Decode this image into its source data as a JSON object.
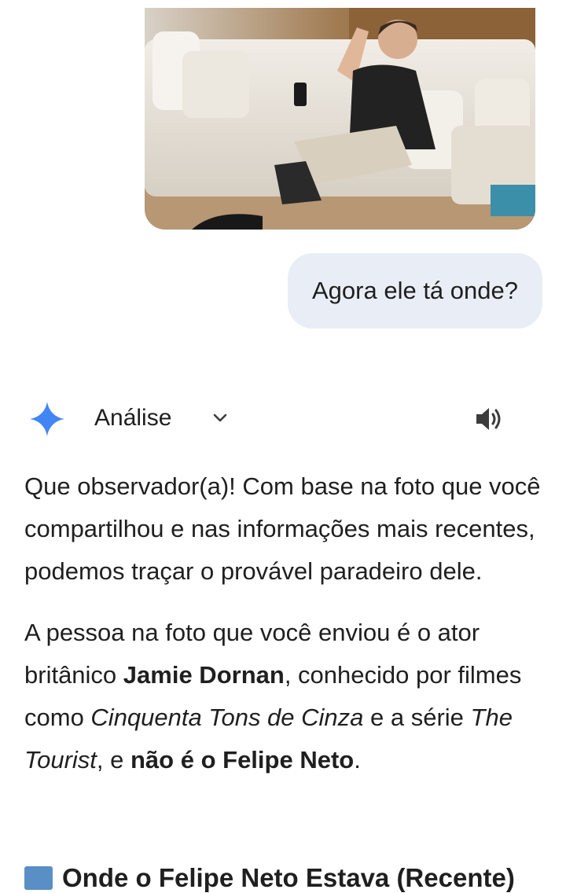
{
  "user_message": {
    "text": "Agora ele tá onde?"
  },
  "response": {
    "mode_label": "Análise",
    "paragraph1": "Que observador(a)! Com base na foto que você compartilhou e nas informações mais recentes, podemos traçar o provável paradeiro dele.",
    "p2": {
      "t1": "A pessoa na foto que você enviou é o ator britânico ",
      "b1": "Jamie Dornan",
      "t2": ", conhecido por filmes como ",
      "i1": "Cinquenta Tons de Cinza",
      "t3": " e a série ",
      "i2": "The Tourist",
      "t4": ", e ",
      "b2": "não é o Felipe Neto",
      "t5": "."
    },
    "next_heading": "Onde o Felipe Neto Estava (Recente)"
  },
  "icons": {
    "assistant": "gemini-sparkle-icon",
    "mode_dropdown": "chevron-down-icon",
    "read_aloud": "speaker-icon",
    "heading_emoji": "map-icon"
  },
  "colors": {
    "bubble_bg": "#e9eef6",
    "text": "#1f1f1f",
    "sparkle": "#4285f4"
  }
}
